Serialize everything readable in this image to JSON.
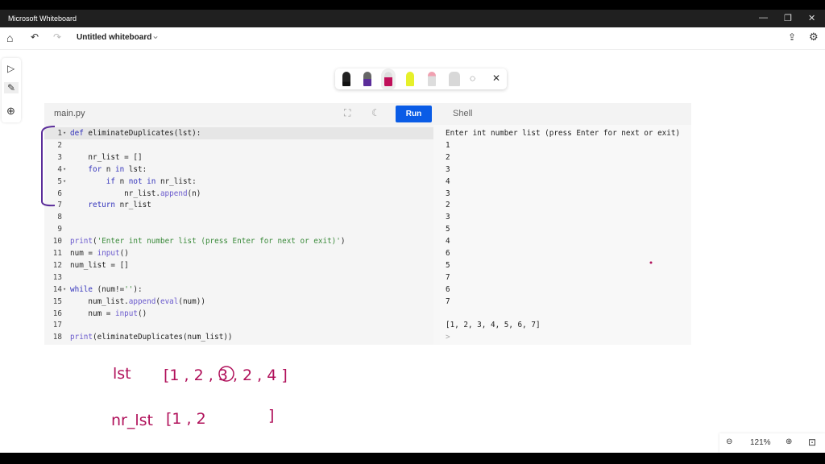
{
  "window": {
    "title": "Microsoft Whiteboard",
    "minimize": "—",
    "restore": "❐",
    "close": "✕"
  },
  "toolbar": {
    "board_title": "Untitled whiteboard",
    "home_icon": "⌂",
    "undo_icon": "↶",
    "redo_icon": "↷",
    "chevron": "⌄",
    "share_icon": "⇪",
    "settings_icon": "⚙"
  },
  "rail": {
    "select": "▷",
    "pen": "✎",
    "add": "⊕"
  },
  "pens": {
    "colors": [
      "#222222",
      "#5b2d9a",
      "#c0105a",
      "#e6f02a",
      "#f0a0b0",
      "#d0d0d0"
    ],
    "lasso": "◌",
    "close": "✕"
  },
  "editor": {
    "tab": "main.py",
    "fullscreen_icon": "⛶",
    "theme_icon": "☾",
    "run": "Run",
    "shell_tab": "Shell",
    "lines": [
      {
        "n": "1",
        "fold": "▾",
        "html": "<span class='kw'>def</span> eliminateDuplicates(lst):"
      },
      {
        "n": "2",
        "fold": "",
        "html": ""
      },
      {
        "n": "3",
        "fold": "",
        "html": "    nr_list = []"
      },
      {
        "n": "4",
        "fold": "▾",
        "html": "    <span class='kw'>for</span> n <span class='kw'>in</span> lst:"
      },
      {
        "n": "5",
        "fold": "▾",
        "html": "        <span class='kw'>if</span> n <span class='kw'>not in</span> nr_list:"
      },
      {
        "n": "6",
        "fold": "",
        "html": "            nr_list.<span class='fn'>append</span>(n)"
      },
      {
        "n": "7",
        "fold": "",
        "html": "    <span class='kw'>return</span> nr_list"
      },
      {
        "n": "8",
        "fold": "",
        "html": ""
      },
      {
        "n": "9",
        "fold": "",
        "html": ""
      },
      {
        "n": "10",
        "fold": "",
        "html": "<span class='fn'>print</span>(<span class='st'>'Enter int number list (press Enter for next or exit)'</span>)"
      },
      {
        "n": "11",
        "fold": "",
        "html": "num = <span class='fn'>input</span>()"
      },
      {
        "n": "12",
        "fold": "",
        "html": "num_list = []"
      },
      {
        "n": "13",
        "fold": "",
        "html": ""
      },
      {
        "n": "14",
        "fold": "▾",
        "html": "<span class='kw'>while</span> (num!=<span class='st'>''</span>):"
      },
      {
        "n": "15",
        "fold": "",
        "html": "    num_list.<span class='fn'>append</span>(<span class='fn'>eval</span>(num))"
      },
      {
        "n": "16",
        "fold": "",
        "html": "    num = <span class='fn'>input</span>()"
      },
      {
        "n": "17",
        "fold": "",
        "html": ""
      },
      {
        "n": "18",
        "fold": "",
        "html": "<span class='fn'>print</span>(eliminateDuplicates(num_list))"
      }
    ]
  },
  "shell": {
    "lines": [
      "Enter int number list (press Enter for next or exit)",
      "1",
      "2",
      "3",
      "4",
      "3",
      "2",
      "3",
      "5",
      "4",
      "6",
      "5",
      "7",
      "6",
      "7",
      "",
      "[1, 2, 3, 4, 5, 6, 7]"
    ],
    "prompt": ">"
  },
  "ink": {
    "label1": "lst",
    "list1": "[1 , 2 , 3 , 2 , 4 ]",
    "label2": "nr_lst",
    "list2": "[1 , 2",
    "close2": "]",
    "color": "#b0105a"
  },
  "zoom": {
    "out": "⊖",
    "level": "121%",
    "in": "⊕",
    "fit": "⊡"
  }
}
